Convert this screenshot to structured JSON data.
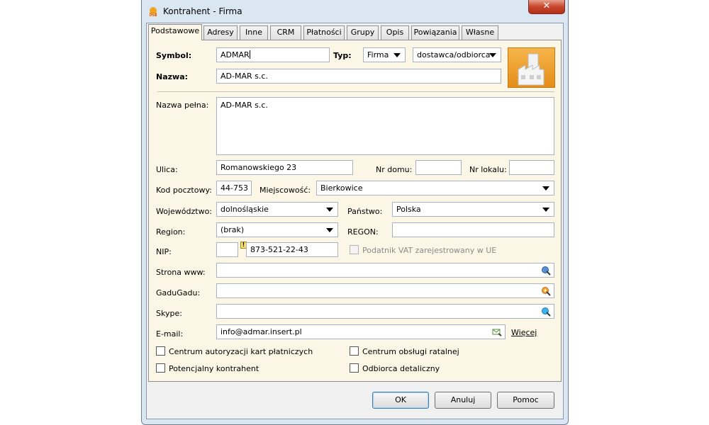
{
  "window": {
    "title": "Kontrahent - Firma",
    "close_label": "✕"
  },
  "tabs": [
    "Podstawowe",
    "Adresy",
    "Inne",
    "CRM",
    "Płatności",
    "Grupy",
    "Opis",
    "Powiązania",
    "Własne"
  ],
  "form": {
    "symbol_label": "Symbol:",
    "symbol_value": "ADMAR",
    "typ_label": "Typ:",
    "typ_value": "Firma",
    "rola_value": "dostawca/odbiorca",
    "nazwa_label": "Nazwa:",
    "nazwa_value": "AD-MAR s.c.",
    "nazwa_pelna_label": "Nazwa pełna:",
    "nazwa_pelna_value": "AD-MAR s.c.",
    "ulica_label": "Ulica:",
    "ulica_value": "Romanowskiego 23",
    "nr_domu_label": "Nr domu:",
    "nr_domu_value": "",
    "nr_lokalu_label": "Nr lokalu:",
    "nr_lokalu_value": "",
    "kod_label": "Kod pocztowy:",
    "kod_value": "44-753",
    "miejscowosc_label": "Miejscowość:",
    "miejscowosc_value": "Bierkowice",
    "wojewodztwo_label": "Województwo:",
    "wojewodztwo_value": "dolnośląskie",
    "panstwo_label": "Państwo:",
    "panstwo_value": "Polska",
    "region_label": "Region:",
    "region_value": "(brak)",
    "regon_label": "REGON:",
    "regon_value": "",
    "nip_label": "NIP:",
    "nip_prefix": "",
    "nip_warning": "!",
    "nip_value": "873-521-22-43",
    "vat_ue_label": "Podatnik VAT zarejestrowany w UE",
    "www_label": "Strona www:",
    "www_value": "",
    "gadu_label": "GaduGadu:",
    "gadu_value": "",
    "skype_label": "Skype:",
    "skype_value": "",
    "email_label": "E-mail:",
    "email_value": "info@admar.insert.pl",
    "more_link": "Więcej",
    "chk_karty": "Centrum autoryzacji kart płatniczych",
    "chk_ratalna": "Centrum obsługi ratalnej",
    "chk_potencjalny": "Potencjalny kontrahent",
    "chk_detaliczny": "Odbiorca detaliczny"
  },
  "buttons": {
    "ok": "OK",
    "cancel": "Anuluj",
    "help": "Pomoc"
  },
  "icons": {
    "app": "contractor-app-icon",
    "logo": "factory-icon",
    "www": "web-globe-icon",
    "gadu": "gadugadu-flower-icon",
    "skype": "skype-icon",
    "email": "send-email-icon"
  }
}
